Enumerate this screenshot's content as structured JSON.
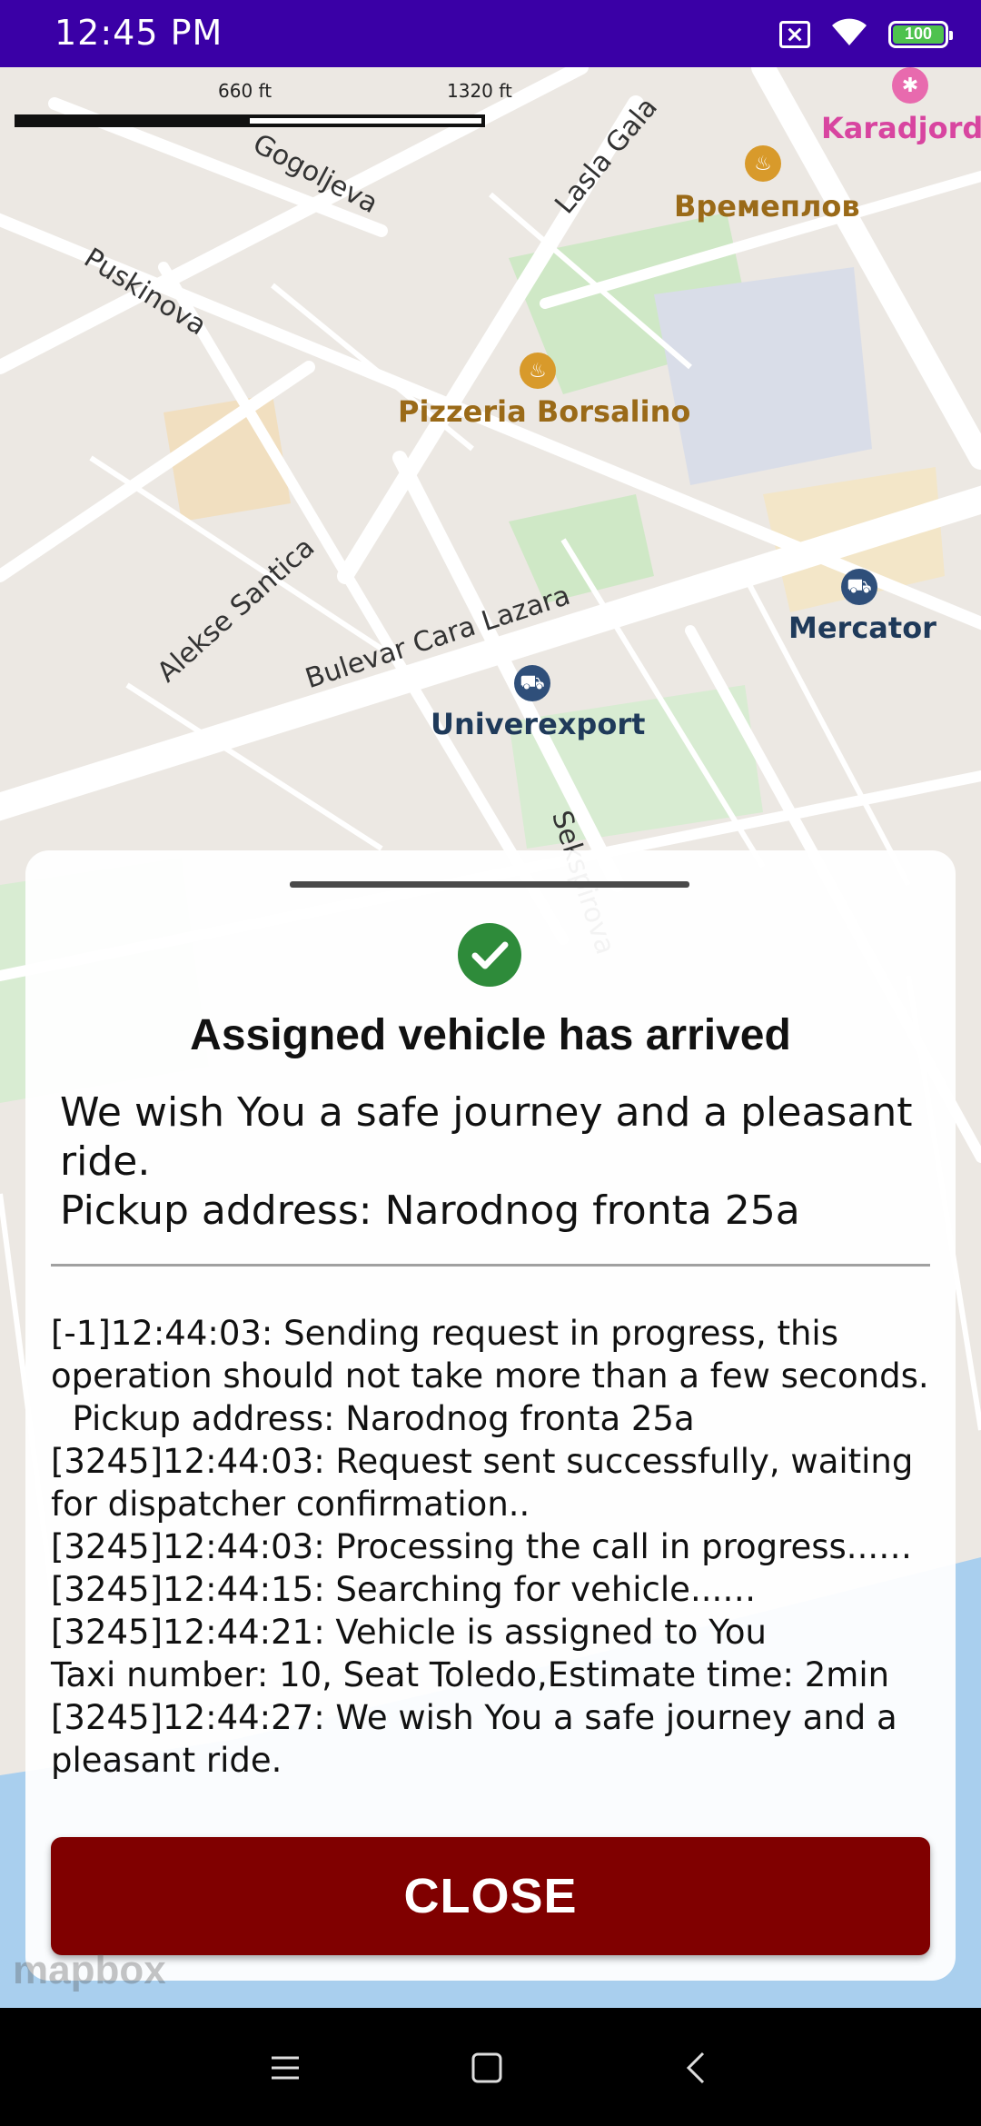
{
  "status_bar": {
    "time": "12:45 PM",
    "battery_level": "100",
    "icons": [
      "sim-off-icon",
      "wifi-icon",
      "battery-icon"
    ]
  },
  "map": {
    "scale": {
      "label_1": "660 ft",
      "label_2": "1320 ft"
    },
    "streets": {
      "gogoljeva": "Gogoljeva",
      "lasla_gala": "Lasla Gala",
      "puskinova": "Puskinova",
      "alekse_santica": "Alekse Santica",
      "bulevar": "Bulevar Cara Lazara",
      "sekspirova": "Sekspirova"
    },
    "pois": {
      "vremeplov": "Времеплов",
      "pizzeria": "Pizzeria Borsalino",
      "mercator": "Mercator",
      "univerexport": "Univerexport",
      "karadjordj": "Karadjordj"
    },
    "attribution": "mapbox"
  },
  "dialog": {
    "title": "Assigned vehicle has arrived",
    "message_line1": "We wish You a safe journey and a pleasant ride.",
    "message_line2": "Pickup address: Narodnog fronta 25a",
    "log": "[-1]12:44:03: Sending request in progress, this operation should not take more than a few seconds.\n  Pickup address: Narodnog fronta 25a\n[3245]12:44:03: Request sent successfully, waiting for dispatcher confirmation..\n[3245]12:44:03: Processing the call in progress...…\n[3245]12:44:15: Searching for vehicle...…\n[3245]12:44:21: Vehicle is assigned to You\nTaxi number: 10, Seat Toledo,Estimate time: 2min\n[3245]12:44:27: We wish You a safe journey and a pleasant ride.",
    "close_label": "CLOSE"
  },
  "colors": {
    "status_bar": "#3a00a6",
    "close_button": "#800000",
    "success_check": "#2e8b3a"
  }
}
